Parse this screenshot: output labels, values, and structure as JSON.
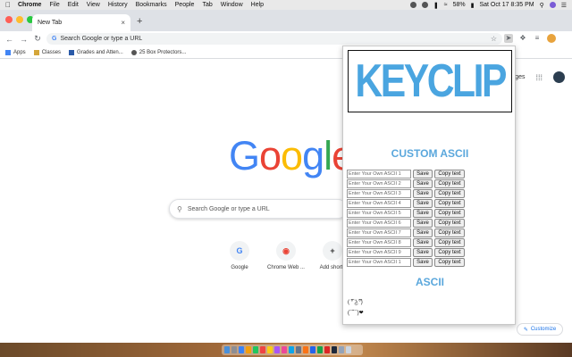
{
  "menubar": {
    "items": [
      "Chrome",
      "File",
      "Edit",
      "View",
      "History",
      "Bookmarks",
      "People",
      "Tab",
      "Window",
      "Help"
    ],
    "battery": "58%",
    "datetime": "Sat Oct 17  8:35 PM"
  },
  "tab": {
    "title": "New Tab"
  },
  "omnibox": {
    "text": "Search Google or type a URL"
  },
  "bookmarks": [
    {
      "label": "Apps",
      "color": "#4285f4"
    },
    {
      "label": "Classes",
      "color": "#d4a63a"
    },
    {
      "label": "Grades and Atten...",
      "color": "#2a5aa8"
    },
    {
      "label": "25 Box Protectors...",
      "color": "#555555"
    }
  ],
  "ntp": {
    "logo": "Google",
    "images_partial": "ges",
    "search_placeholder": "Search Google or type a URL",
    "shortcuts": [
      {
        "label": "Google",
        "glyph": "G"
      },
      {
        "label": "Chrome Web ...",
        "glyph": "◉"
      },
      {
        "label": "Add shortc",
        "glyph": "+"
      }
    ],
    "customize": "Customize"
  },
  "popup": {
    "title": "KEYCLIP",
    "custom_heading": "CUSTOM ASCII",
    "save_label": "Save",
    "copy_label": "Copy text",
    "placeholders": [
      "Enter Your Own ASCII 1",
      "Enter Your Own ASCII 2",
      "Enter Your Own ASCII 3",
      "Enter Your Own ASCII 4",
      "Enter Your Own ASCII 5",
      "Enter Your Own ASCII 6",
      "Enter Your Own ASCII 7",
      "Enter Your Own ASCII 8",
      "Enter Your Own ASCII 9",
      "Enter Your Own ASCII 1"
    ],
    "ascii_heading": "ASCII",
    "ascii_items": [
      "( ͡° ͜ʖ ͡°)",
      "(¯˘¯)❤"
    ]
  },
  "colors": {
    "accent": "#5aa7dc",
    "google_blue": "#4285f4",
    "google_red": "#ea4335",
    "google_yellow": "#fbbc05",
    "google_green": "#34a853"
  }
}
